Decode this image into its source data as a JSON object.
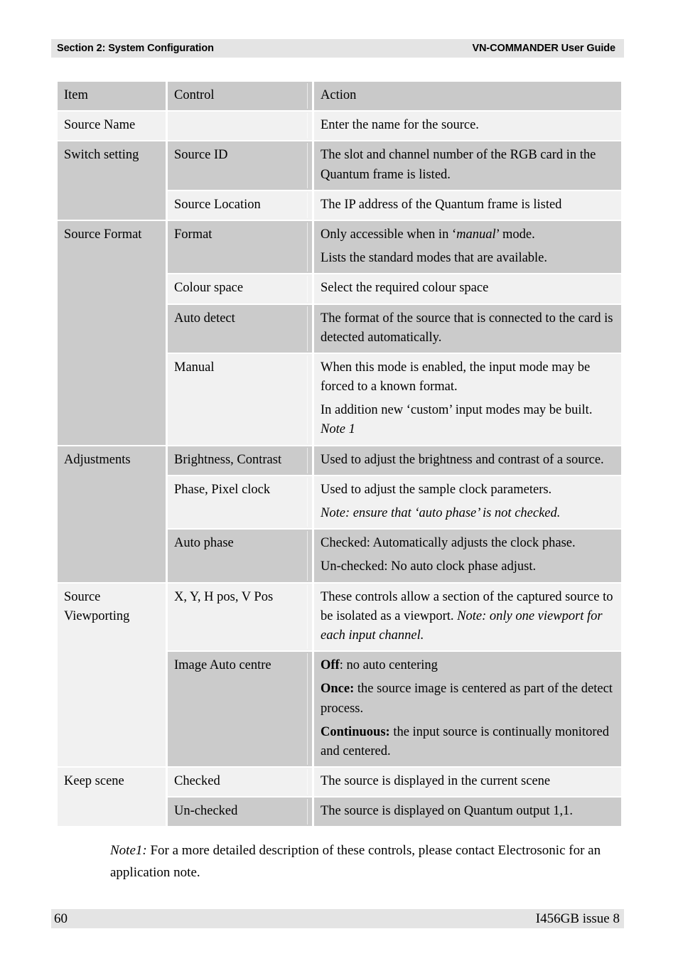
{
  "running_head": {
    "left": "Section 2: System Configuration",
    "right": "VN-COMMANDER User Guide"
  },
  "table": {
    "headers": {
      "item": "Item",
      "control": "Control",
      "action": "Action"
    },
    "rows": [
      {
        "item": "Source Name",
        "control": "",
        "action_lines": [
          "Enter the name for the source."
        ]
      },
      {
        "item": "Switch setting",
        "control": "Source ID",
        "action_lines": [
          "The slot and channel number of the RGB card in the Quantum frame is listed."
        ]
      },
      {
        "item": "",
        "control": "Source Location",
        "action_lines": [
          "The IP address of the Quantum frame is listed"
        ]
      },
      {
        "item": "Source Format",
        "control": "Format",
        "action_lines": [
          "Only accessible when in ‘manual’ mode.",
          "Lists the standard modes that are available."
        ],
        "action_italic_word": "manual"
      },
      {
        "item": "",
        "control": "Colour space",
        "action_lines": [
          "Select the required colour space"
        ]
      },
      {
        "item": "",
        "control": "Auto detect",
        "action_lines": [
          "The format of the source that is connected to the card is detected automatically."
        ]
      },
      {
        "item": "",
        "control": "Manual",
        "action_lines": [
          "When this mode is enabled, the input mode may be forced to a known format.",
          "In addition new ‘custom’ input modes may be built. Note 1"
        ],
        "action_italic_word": "Note 1"
      },
      {
        "item": "Adjustments",
        "control": "Brightness, Contrast",
        "action_lines": [
          "Used to adjust the brightness and contrast of a source."
        ]
      },
      {
        "item": "",
        "control": "Phase, Pixel clock",
        "action_lines": [
          "Used to adjust the sample clock parameters.",
          "Note: ensure that ‘auto phase’ is not checked."
        ]
      },
      {
        "item": "",
        "control": "Auto phase",
        "action_lines": [
          "Checked: Automatically adjusts the clock phase.",
          "Un-checked: No auto clock phase adjust."
        ]
      },
      {
        "item": "Source Viewporting",
        "control": "X, Y, H pos, V Pos",
        "action_lines": [
          "These controls allow a section of the captured source to be isolated as a viewport. Note: only one viewport for each input channel."
        ],
        "action_italic_word": "Note: only one viewport for each input channel."
      },
      {
        "item": "",
        "control": "Image Auto centre",
        "action_lines": [
          "Off:  no auto centering",
          "Once: the source image is centered as part of the detect process.",
          "Continuous: the input source is continually monitored and centered."
        ],
        "action_bold_words": [
          "Off",
          "Once:",
          "Continuous:"
        ]
      },
      {
        "item": "Keep scene",
        "control": "Checked",
        "action_lines": [
          "The source is displayed in the current scene"
        ]
      },
      {
        "item": "",
        "control": "Un-checked",
        "action_lines": [
          "The source is displayed on Quantum output 1,1."
        ]
      }
    ]
  },
  "note": {
    "label": "Note1:",
    "text": " For a more detailed description of these controls, please contact Electrosonic for an application note."
  },
  "footer": {
    "page_number": "60",
    "document_code": "I456GB issue 8"
  }
}
